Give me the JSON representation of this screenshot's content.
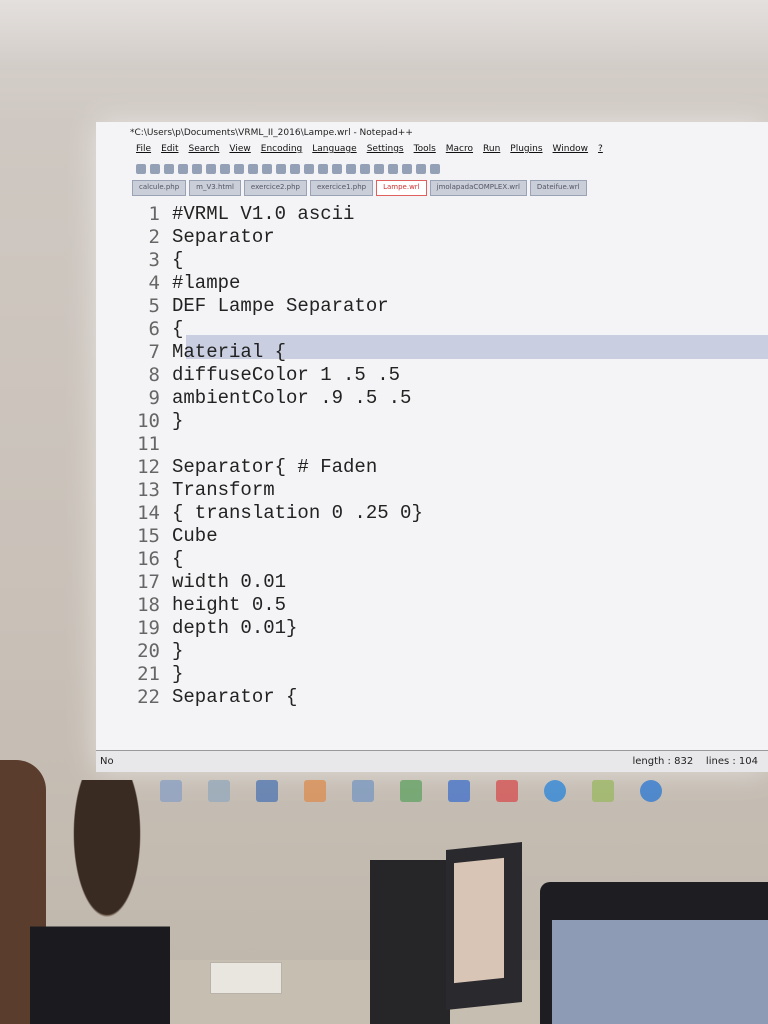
{
  "window": {
    "title": "*C:\\Users\\p\\Documents\\VRML_II_2016\\Lampe.wrl - Notepad++"
  },
  "menu": [
    "File",
    "Edit",
    "Search",
    "View",
    "Encoding",
    "Language",
    "Settings",
    "Tools",
    "Macro",
    "Run",
    "Plugins",
    "Window",
    "?"
  ],
  "tabs": [
    {
      "label": "calcule.php"
    },
    {
      "label": "m_V3.html"
    },
    {
      "label": "exercice2.php"
    },
    {
      "label": "exercice1.php"
    },
    {
      "label": "Lampe.wrl",
      "active": true
    },
    {
      "label": "jmolapadaCOMPLEX.wrl"
    },
    {
      "label": "Dateifue.wrl"
    }
  ],
  "editor": {
    "lines": [
      {
        "n": "1",
        "text": "#VRML V1.0 ascii"
      },
      {
        "n": "2",
        "text": "Separator"
      },
      {
        "n": "3",
        "text": "{"
      },
      {
        "n": "4",
        "text": "#lampe"
      },
      {
        "n": "5",
        "text": "DEF Lampe Separator"
      },
      {
        "n": "6",
        "text": "{"
      },
      {
        "n": "7",
        "text": "Material {"
      },
      {
        "n": "8",
        "text": "diffuseColor 1 .5 .5"
      },
      {
        "n": "9",
        "text": "ambientColor .9 .5 .5"
      },
      {
        "n": "10",
        "text": "}"
      },
      {
        "n": "11",
        "text": ""
      },
      {
        "n": "12",
        "text": "Separator{ # Faden"
      },
      {
        "n": "13",
        "text": "Transform"
      },
      {
        "n": "14",
        "text": "{ translation 0 .25 0}"
      },
      {
        "n": "15",
        "text": "Cube"
      },
      {
        "n": "16",
        "text": "{"
      },
      {
        "n": "17",
        "text": "width 0.01"
      },
      {
        "n": "18",
        "text": "height 0.5"
      },
      {
        "n": "19",
        "text": "depth 0.01}"
      },
      {
        "n": "20",
        "text": "}"
      },
      {
        "n": "21",
        "text": "}"
      },
      {
        "n": "22",
        "text": "Separator {"
      }
    ]
  },
  "status": {
    "left": "No",
    "length": "length : 832",
    "lines": "lines : 104"
  },
  "taskbar_icons": [
    "search-icon",
    "task-view-icon",
    "vrml-icon",
    "layers-icon",
    "folder-icon",
    "excel-icon",
    "outlook-icon",
    "word-icon",
    "skype-icon",
    "notepadpp-icon",
    "ie-icon"
  ]
}
